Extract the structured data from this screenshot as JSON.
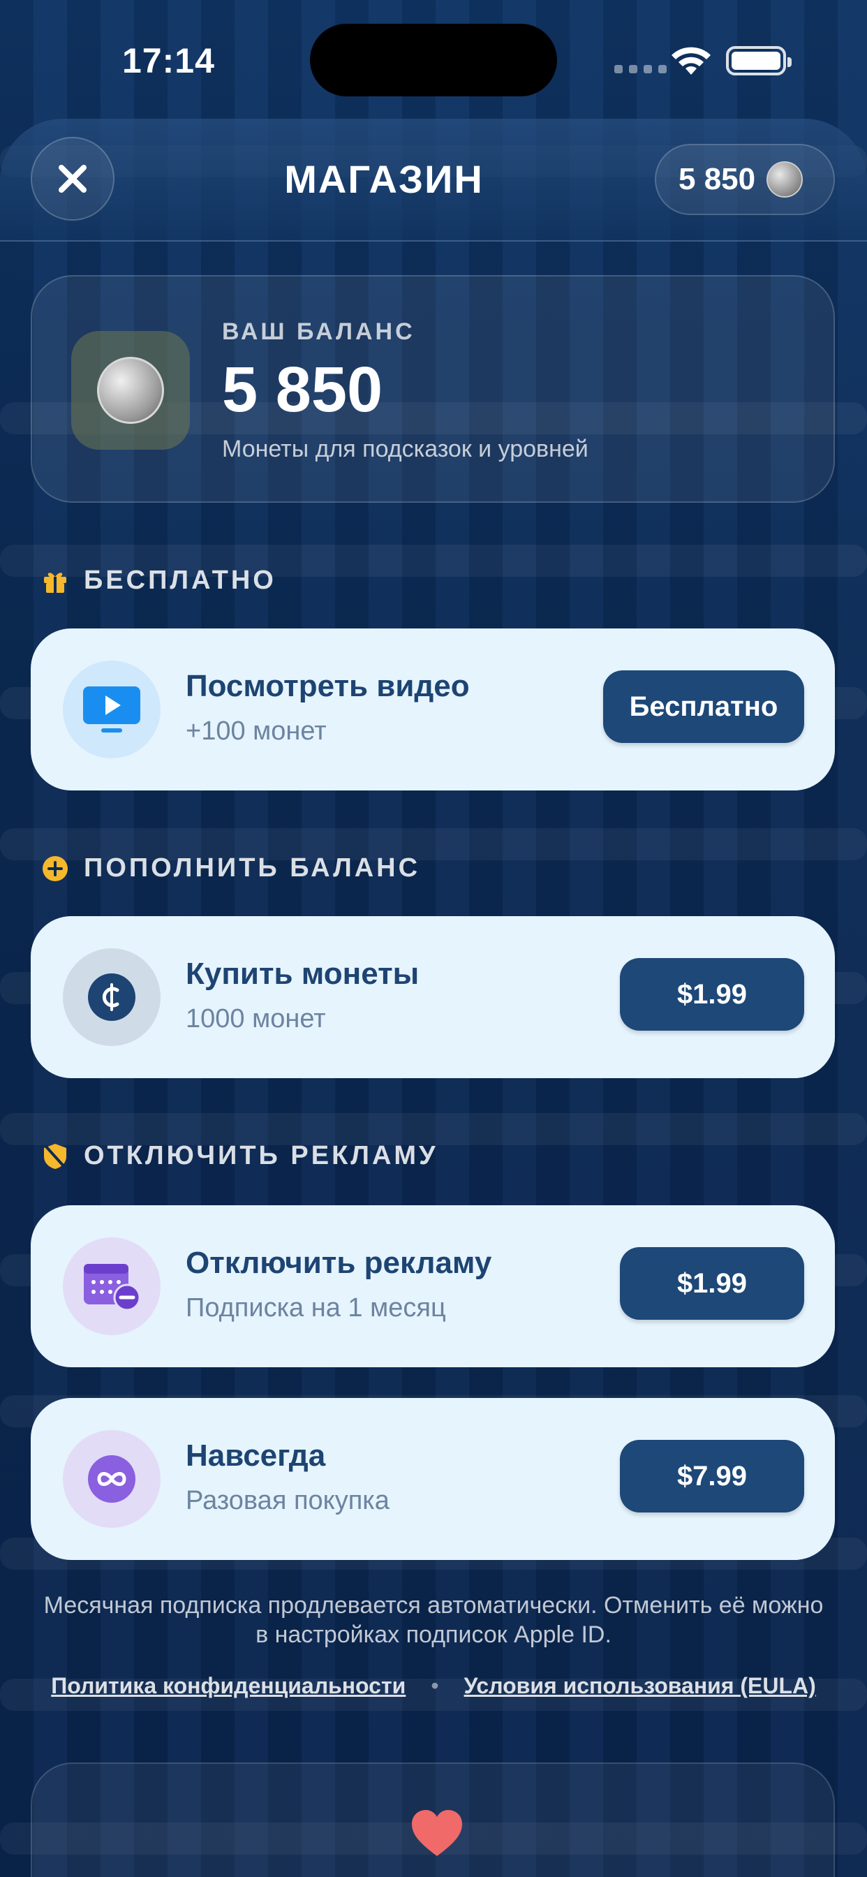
{
  "status_bar": {
    "time": "17:14"
  },
  "header": {
    "title": "МАГАЗИН",
    "balance": "5 850"
  },
  "balance_card": {
    "label": "ВАШ БАЛАНС",
    "value": "5 850",
    "subtitle": "Монеты для подсказок и уровней"
  },
  "sections": {
    "free": {
      "title": "БЕСПЛАТНО",
      "item": {
        "title": "Посмотреть видео",
        "subtitle": "+100 монет",
        "button": "Бесплатно"
      }
    },
    "topup": {
      "title": "ПОПОЛНИТЬ БАЛАНС",
      "item": {
        "title": "Купить монеты",
        "subtitle": "1000 монет",
        "button": "$1.99"
      }
    },
    "noads": {
      "title": "ОТКЛЮЧИТЬ РЕКЛАМУ",
      "items": [
        {
          "title": "Отключить рекламу",
          "subtitle": "Подписка на 1 месяц",
          "button": "$1.99"
        },
        {
          "title": "Навсегда",
          "subtitle": "Разовая покупка",
          "button": "$7.99"
        }
      ]
    }
  },
  "footer": {
    "note": "Месячная подписка продлевается автоматически. Отменить её можно в настройках подписок Apple ID.",
    "privacy_link": "Политика конфиденциальности",
    "separator": "•",
    "terms_link": "Условия использования (EULA)"
  },
  "colors": {
    "background": "#0d2a52",
    "card": "#e6f4fd",
    "button": "#1d4878",
    "title_text": "#1d4472",
    "accent_gold": "#f5b72c",
    "heart": "#f06a6a"
  },
  "icons": [
    "close-icon",
    "coin-icon",
    "gift-icon",
    "video-icon",
    "plus-circle-icon",
    "cent-icon",
    "ad-block-icon",
    "calendar-minus-icon",
    "infinity-icon",
    "heart-icon"
  ]
}
